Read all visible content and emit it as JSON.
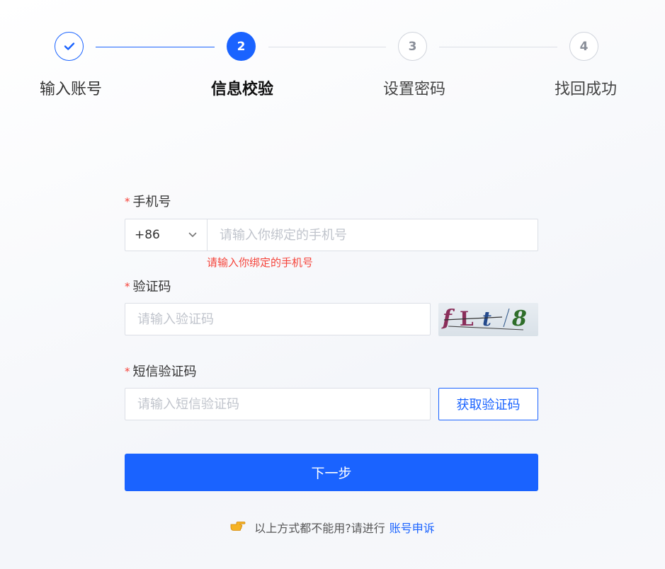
{
  "steps": [
    {
      "label": "输入账号",
      "state": "done"
    },
    {
      "label": "信息校验",
      "number": "2",
      "state": "active"
    },
    {
      "label": "设置密码",
      "number": "3",
      "state": "todo"
    },
    {
      "label": "找回成功",
      "number": "4",
      "state": "todo"
    }
  ],
  "form": {
    "required_mark": "*",
    "phone": {
      "label": "手机号",
      "country_code": "+86",
      "placeholder": "请输入你绑定的手机号",
      "error": "请输入你绑定的手机号"
    },
    "captcha": {
      "label": "验证码",
      "placeholder": "请输入验证码",
      "image_text": "fLt8"
    },
    "sms": {
      "label": "短信验证码",
      "placeholder": "请输入短信验证码",
      "button": "获取验证码"
    },
    "submit": "下一步"
  },
  "footer": {
    "hint": "以上方式都不能用?请进行",
    "link": "账号申诉",
    "icon": "pointing-hand-icon"
  },
  "colors": {
    "primary": "#1a63ff",
    "error": "#f5443b"
  }
}
